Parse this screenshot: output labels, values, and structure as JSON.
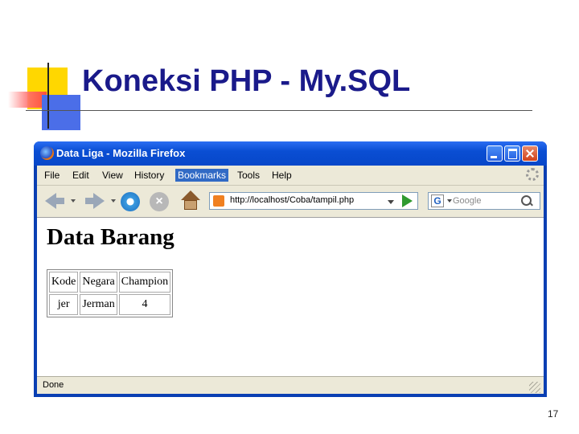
{
  "slide": {
    "title": "Koneksi PHP - My.SQL",
    "page_number": "17"
  },
  "browser": {
    "window_title": "Data Liga - Mozilla Firefox",
    "menu": [
      {
        "label": "File"
      },
      {
        "label": "Edit"
      },
      {
        "label": "View"
      },
      {
        "label": "History"
      },
      {
        "label": "Bookmarks"
      },
      {
        "label": "Tools"
      },
      {
        "label": "Help"
      }
    ],
    "active_menu": "Bookmarks",
    "url": "http://localhost/Coba/tampil.php",
    "search_placeholder": "Google",
    "search_engine_icon": "G",
    "status": "Done"
  },
  "page": {
    "heading": "Data Barang",
    "table": {
      "headers": [
        "Kode",
        "Negara",
        "Champion"
      ],
      "rows": [
        [
          "jer",
          "Jerman",
          "4"
        ]
      ]
    }
  },
  "colors": {
    "title_text": "#1a1a8a",
    "titlebar": "#0a4ed3",
    "menu_highlight": "#316ac5",
    "chrome": "#ece9d8"
  }
}
